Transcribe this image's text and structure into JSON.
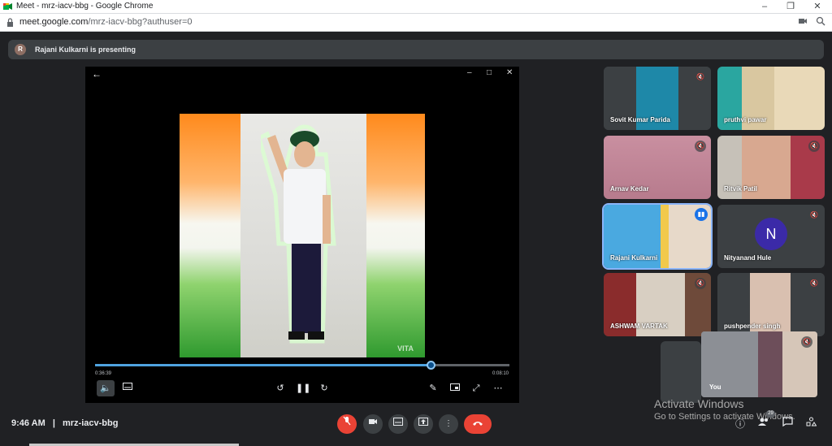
{
  "browser": {
    "title": "Meet - mrz-iacv-bbg - Google Chrome",
    "url_host": "meet.google.com",
    "url_path": "/mrz-iacv-bbg?authuser=0"
  },
  "banner": {
    "avatar_letter": "R",
    "text": "Rajani Kulkarni is presenting"
  },
  "presentation": {
    "elapsed": "0:36:39",
    "duration": "0:08:10",
    "progress_fraction": 0.81,
    "watermark": "VITA"
  },
  "participants": [
    {
      "name": "Sovit Kumar Parida",
      "muted": true
    },
    {
      "name": "pruthvi pawar",
      "muted": false
    },
    {
      "name": "Arnav Kedar",
      "muted": true
    },
    {
      "name": "Ritvik Patil",
      "muted": true
    },
    {
      "name": "Rajani Kulkarni",
      "muted": false,
      "speaking": true
    },
    {
      "name": "Nityanand Hule",
      "muted": true,
      "avatar_letter": "N"
    },
    {
      "name": "ASHWAM VARTAK",
      "muted": true
    },
    {
      "name": "pushpender singh",
      "muted": true
    }
  ],
  "self": {
    "name": "You"
  },
  "footer": {
    "time": "9:46 AM",
    "separator": "|",
    "meeting_code": "mrz-iacv-bbg",
    "participant_count": "29"
  },
  "watermark": {
    "line1": "Activate Windows",
    "line2": "Go to Settings to activate Windows."
  },
  "colors": {
    "background": "#202124",
    "end_call": "#ea4335",
    "active_outline": "#8ab4f8",
    "avatar_purple": "#3b2aa8"
  }
}
